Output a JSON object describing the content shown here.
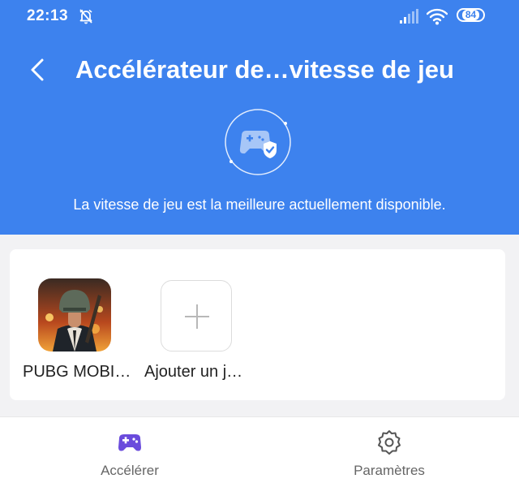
{
  "status_bar": {
    "time": "22:13",
    "battery": "84"
  },
  "header": {
    "title": "Accélérateur de…vitesse de jeu",
    "subtitle": "La vitesse de jeu est la meilleure actuellement disponible."
  },
  "games": [
    {
      "label": "PUBG MOBI…",
      "icon": "pubg-mobile-app-icon"
    },
    {
      "label": "Ajouter un j…",
      "icon": "plus-icon"
    }
  ],
  "bottom_nav": [
    {
      "label": "Accélérer",
      "icon": "gamepad-icon",
      "active": true
    },
    {
      "label": "Paramètres",
      "icon": "gear-icon",
      "active": false
    }
  ],
  "colors": {
    "header_bg": "#3d82ee",
    "active_nav": "#6a4bdc",
    "inactive_nav": "#666666"
  }
}
